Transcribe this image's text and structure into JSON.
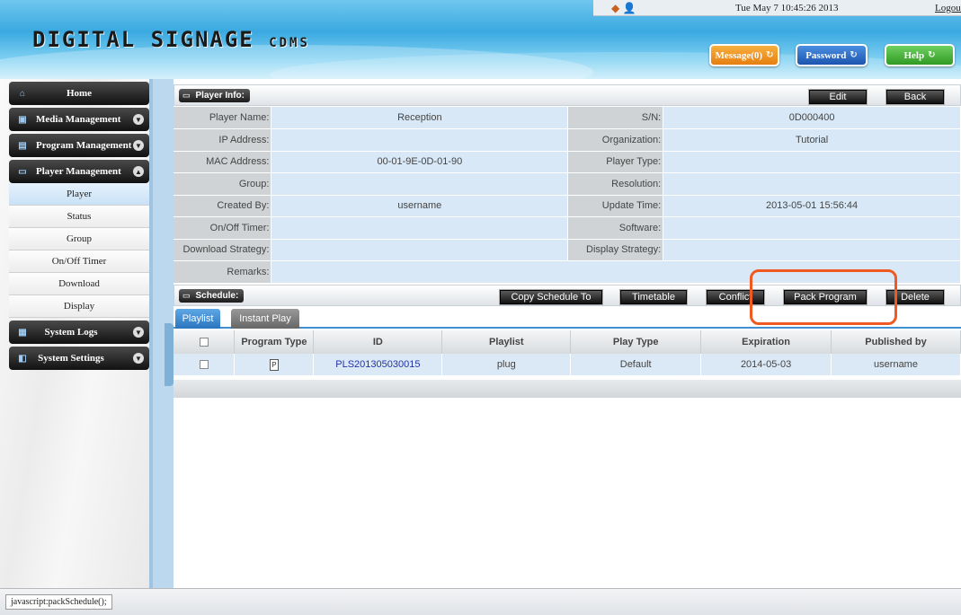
{
  "header": {
    "logo_main": "DIGITAL SIGNAGE",
    "logo_sub": "CDMS",
    "datetime": "Tue May 7 10:45:26 2013",
    "logout": "Logout",
    "message_btn": "Message(0)",
    "password_btn": "Password",
    "help_btn": "Help"
  },
  "sidebar": {
    "home": "Home",
    "media": "Media Management",
    "program": "Program Management",
    "player": "Player Management",
    "sub_items": [
      "Player",
      "Status",
      "Group",
      "On/Off Timer",
      "Download",
      "Display"
    ],
    "logs": "System Logs",
    "settings": "System Settings"
  },
  "player_info": {
    "title": "Player Info:",
    "edit": "Edit",
    "back": "Back",
    "rows": [
      {
        "k1": "Player Name:",
        "v1": "Reception",
        "k2": "S/N:",
        "v2": "0D000400"
      },
      {
        "k1": "IP Address:",
        "v1": "",
        "k2": "Organization:",
        "v2": "Tutorial"
      },
      {
        "k1": "MAC Address:",
        "v1": "00-01-9E-0D-01-90",
        "k2": "Player Type:",
        "v2": ""
      },
      {
        "k1": "Group:",
        "v1": "",
        "k2": "Resolution:",
        "v2": ""
      },
      {
        "k1": "Created By:",
        "v1": "username",
        "k2": "Update Time:",
        "v2": "2013-05-01 15:56:44"
      },
      {
        "k1": "On/Off Timer:",
        "v1": "",
        "k2": "Software:",
        "v2": ""
      },
      {
        "k1": "Download Strategy:",
        "v1": "",
        "k2": "Display Strategy:",
        "v2": ""
      }
    ],
    "remarks_label": "Remarks:",
    "remarks_value": ""
  },
  "schedule": {
    "title": "Schedule:",
    "copy_btn": "Copy Schedule To",
    "timetable_btn": "Timetable",
    "conflict_btn": "Conflict",
    "pack_btn": "Pack Program",
    "delete_btn": "Delete",
    "tab_playlist": "Playlist",
    "tab_instant": "Instant Play",
    "columns": [
      "Program Type",
      "ID",
      "Playlist",
      "Play Type",
      "Expiration",
      "Published by"
    ],
    "rows": [
      {
        "id": "PLS201305030015",
        "playlist": "plug",
        "play_type": "Default",
        "expiration": "2014-05-03",
        "published_by": "username"
      }
    ]
  },
  "status_bar": "javascript:packSchedule();"
}
